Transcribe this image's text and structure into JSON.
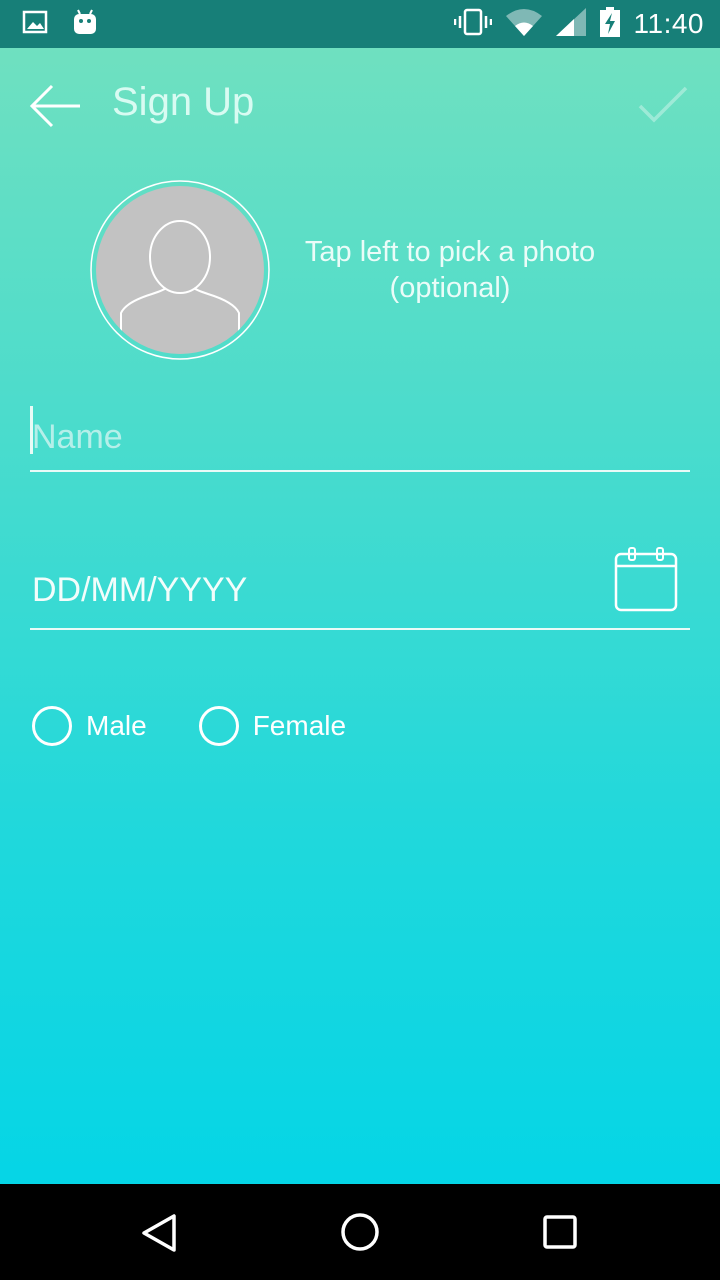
{
  "status_bar": {
    "time": "11:40",
    "icons": [
      "gallery-icon",
      "android-icon",
      "vibrate-icon",
      "wifi-icon",
      "signal-icon",
      "battery-charging-icon"
    ]
  },
  "toolbar": {
    "title": "Sign Up",
    "back_icon": "arrow-left-icon",
    "done_icon": "check-icon"
  },
  "photo": {
    "hint": "Tap left to pick a photo\n(optional)",
    "avatar_icon": "person-placeholder-icon"
  },
  "form": {
    "name_placeholder": "Name",
    "dob_placeholder": "DD/MM/YYYY",
    "calendar_icon": "calendar-icon",
    "gender_options": [
      "Male",
      "Female"
    ]
  },
  "nav_bar": {
    "icons": [
      "back-triangle-icon",
      "home-circle-icon",
      "recents-square-icon"
    ]
  },
  "colors": {
    "status_bar": "#177f78",
    "gradient_top": "#6fe0c0",
    "gradient_bottom": "#05d5e6",
    "text": "#ffffff"
  }
}
